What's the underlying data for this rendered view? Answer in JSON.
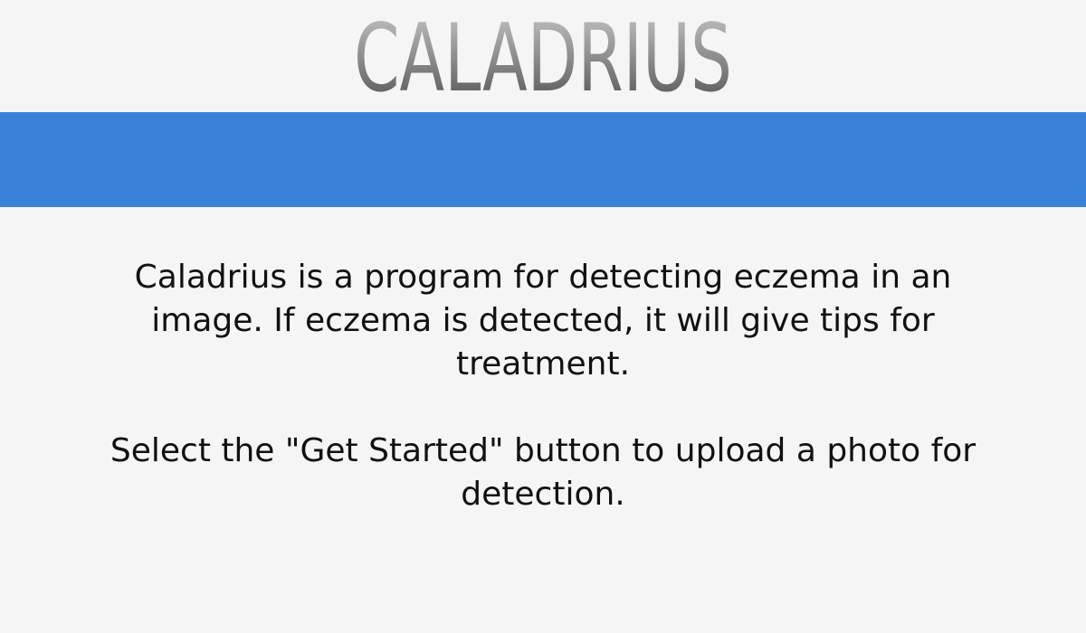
{
  "header": {
    "logo_text": "CALADRIUS"
  },
  "band": {
    "color": "#3a82d9"
  },
  "main": {
    "intro": "Caladrius is a program for detecting eczema in an image. If eczema is detected, it will give tips for treatment.",
    "instructions": "Select the \"Get Started\" button to upload a photo for detection."
  }
}
